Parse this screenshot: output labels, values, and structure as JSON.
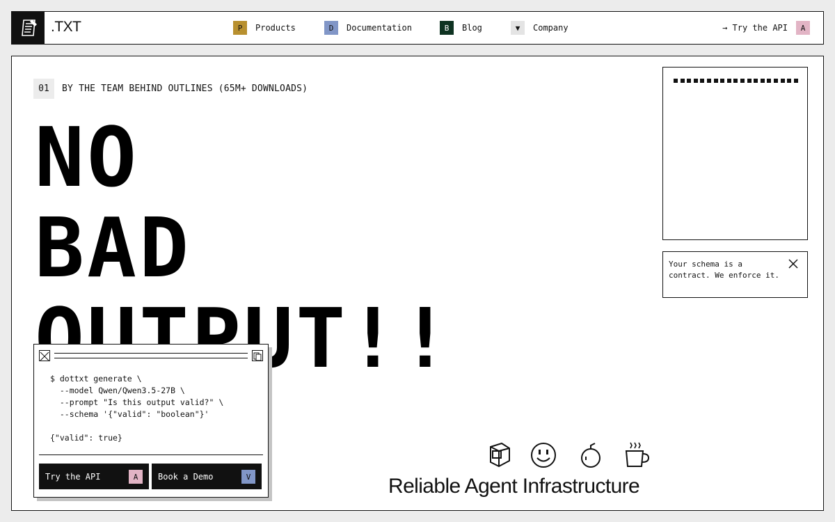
{
  "nav": {
    "brand": ".TXT",
    "items": [
      {
        "key": "P",
        "label": "Products",
        "color": "#b8902f",
        "text_color": "#111111"
      },
      {
        "key": "D",
        "label": "Documentation",
        "color": "#8196c7",
        "text_color": "#111111"
      },
      {
        "key": "B",
        "label": "Blog",
        "color": "#0f3322",
        "text_color": "#ffffff"
      },
      {
        "key": "▼",
        "label": "Company",
        "color": "#e4e4e4",
        "text_color": "#111111"
      }
    ],
    "cta": {
      "label": "→ Try the API",
      "key": "A",
      "color": "#e2b4c5"
    }
  },
  "hero": {
    "eyebrow_num": "01",
    "eyebrow_text": "BY THE TEAM BEHIND OUTLINES (65M+ DOWNLOADS)",
    "headline": [
      "NO",
      "BAD",
      "OUTPUT!!"
    ]
  },
  "toast": {
    "text": "Your schema is a contract. We enforce it."
  },
  "terminal": {
    "code": "$ dottxt generate \\\n  --model Qwen/Qwen3.5-27B \\\n  --prompt \"Is this output valid?\" \\\n  --schema '{\"valid\": \"boolean\"}'\n\n{\"valid\": true}",
    "buttons": [
      {
        "label": "Try the API",
        "key": "A",
        "color": "#e2b4c5"
      },
      {
        "label": "Book a Demo",
        "key": "V",
        "color": "#8196c7"
      }
    ]
  },
  "footer": {
    "tagline": "Reliable Agent Infrastructure",
    "icons": [
      "computer-icon",
      "smiley-icon",
      "bomb-icon",
      "coffee-cup-icon"
    ]
  }
}
